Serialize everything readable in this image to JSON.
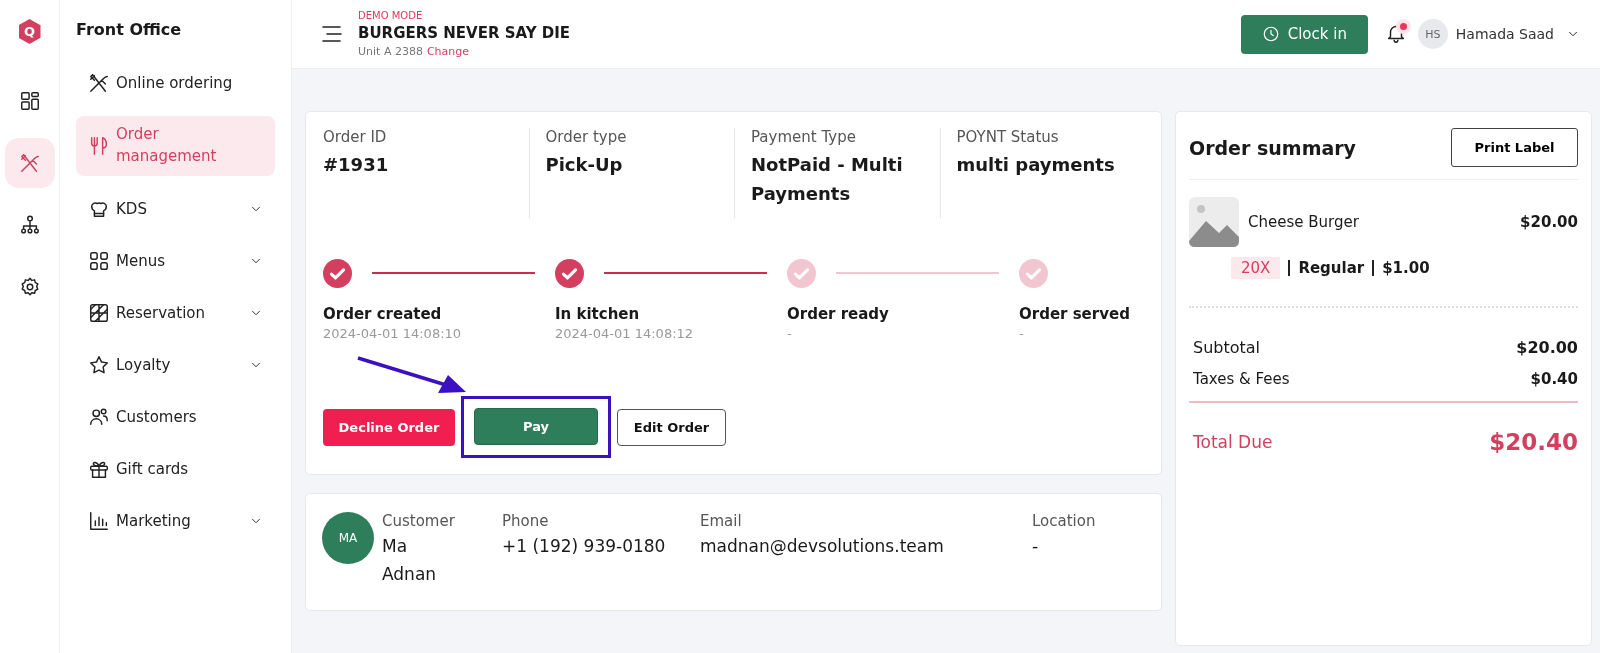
{
  "rail": {
    "logo": "Q",
    "items": [
      {
        "selected": false
      },
      {
        "selected": true
      },
      {
        "selected": false
      },
      {
        "selected": false
      }
    ]
  },
  "sidebar": {
    "title": "Front Office",
    "items": [
      {
        "label": "Online ordering",
        "selected": false,
        "expandable": false
      },
      {
        "label": "Order management",
        "selected": true,
        "expandable": false
      },
      {
        "label": "KDS",
        "selected": false,
        "expandable": true
      },
      {
        "label": "Menus",
        "selected": false,
        "expandable": true
      },
      {
        "label": "Reservation",
        "selected": false,
        "expandable": true
      },
      {
        "label": "Loyalty",
        "selected": false,
        "expandable": true
      },
      {
        "label": "Customers",
        "selected": false,
        "expandable": false
      },
      {
        "label": "Gift cards",
        "selected": false,
        "expandable": false
      },
      {
        "label": "Marketing",
        "selected": false,
        "expandable": true
      }
    ]
  },
  "header": {
    "mode": "DEMO MODE",
    "restaurant": "BURGERS NEVER SAY DIE",
    "unit": "Unit A 2388",
    "change_link": "Change",
    "clock_button": "Clock in",
    "notification_unread": true,
    "user_initials": "HS",
    "user_name": "Hamada Saad"
  },
  "order": {
    "fields": [
      {
        "label": "Order ID",
        "value": "#1931"
      },
      {
        "label": "Order type",
        "value": "Pick-Up"
      },
      {
        "label": "Payment Type",
        "value": "NotPaid - Multi Payments"
      },
      {
        "label": "POYNT Status",
        "value": "multi payments"
      }
    ],
    "steps": [
      {
        "label": "Order created",
        "time": "2024-04-01 14:08:10",
        "done": true
      },
      {
        "label": "In kitchen",
        "time": "2024-04-01 14:08:12",
        "done": true
      },
      {
        "label": "Order ready",
        "time": "-",
        "done": false
      },
      {
        "label": "Order served",
        "time": "-",
        "done": false
      }
    ],
    "buttons": [
      {
        "label": "Decline Order",
        "kind": "danger",
        "highlighted": false
      },
      {
        "label": "Pay",
        "kind": "primary",
        "highlighted": true
      },
      {
        "label": "Edit Order",
        "kind": "outline",
        "highlighted": false
      }
    ]
  },
  "customer": {
    "initials": "MA",
    "fields": [
      {
        "label": "Customer",
        "value": "Ma Adnan"
      },
      {
        "label": "Phone",
        "value": "+1 (192) 939-0180"
      },
      {
        "label": "Email",
        "value": "madnan@devsolutions.team"
      },
      {
        "label": "Location",
        "value": "-"
      }
    ]
  },
  "summary": {
    "title": "Order summary",
    "print_button": "Print Label",
    "items": [
      {
        "name": "Cheese Burger",
        "price": "$20.00",
        "quantity": "20X",
        "variant": "Regular",
        "variant_price": "$1.00"
      }
    ],
    "rows": [
      {
        "label": "Subtotal",
        "value": "$20.00"
      },
      {
        "label": "Taxes & Fees",
        "value": "$0.40"
      }
    ],
    "total": {
      "label": "Total Due",
      "value": "$20.40"
    }
  }
}
